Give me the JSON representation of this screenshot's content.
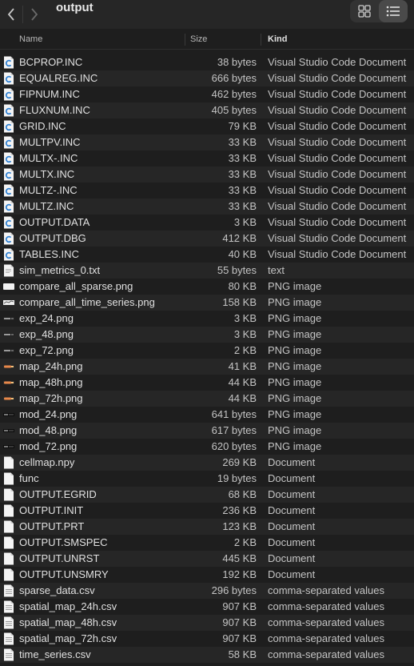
{
  "window": {
    "title": "output"
  },
  "columns": {
    "name": "Name",
    "size": "Size",
    "kind": "Kind"
  },
  "files": [
    {
      "name": "BCPROP.INC",
      "size": "38 bytes",
      "kind": "Visual Studio Code Document",
      "icon": "vscode-doc-icon"
    },
    {
      "name": "EQUALREG.INC",
      "size": "666 bytes",
      "kind": "Visual Studio Code Document",
      "icon": "vscode-doc-icon"
    },
    {
      "name": "FIPNUM.INC",
      "size": "462 bytes",
      "kind": "Visual Studio Code Document",
      "icon": "vscode-doc-icon"
    },
    {
      "name": "FLUXNUM.INC",
      "size": "405 bytes",
      "kind": "Visual Studio Code Document",
      "icon": "vscode-doc-icon"
    },
    {
      "name": "GRID.INC",
      "size": "79 KB",
      "kind": "Visual Studio Code Document",
      "icon": "vscode-doc-icon"
    },
    {
      "name": "MULTPV.INC",
      "size": "33 KB",
      "kind": "Visual Studio Code Document",
      "icon": "vscode-doc-icon"
    },
    {
      "name": "MULTX-.INC",
      "size": "33 KB",
      "kind": "Visual Studio Code Document",
      "icon": "vscode-doc-icon"
    },
    {
      "name": "MULTX.INC",
      "size": "33 KB",
      "kind": "Visual Studio Code Document",
      "icon": "vscode-doc-icon"
    },
    {
      "name": "MULTZ-.INC",
      "size": "33 KB",
      "kind": "Visual Studio Code Document",
      "icon": "vscode-doc-icon"
    },
    {
      "name": "MULTZ.INC",
      "size": "33 KB",
      "kind": "Visual Studio Code Document",
      "icon": "vscode-doc-icon"
    },
    {
      "name": "OUTPUT.DATA",
      "size": "3 KB",
      "kind": "Visual Studio Code Document",
      "icon": "vscode-doc-icon"
    },
    {
      "name": "OUTPUT.DBG",
      "size": "412 KB",
      "kind": "Visual Studio Code Document",
      "icon": "vscode-doc-icon"
    },
    {
      "name": "TABLES.INC",
      "size": "40 KB",
      "kind": "Visual Studio Code Document",
      "icon": "vscode-doc-icon"
    },
    {
      "name": "sim_metrics_0.txt",
      "size": "55 bytes",
      "kind": "text",
      "icon": "text-file-icon"
    },
    {
      "name": "compare_all_sparse.png",
      "size": "80 KB",
      "kind": "PNG image",
      "icon": "image-thumbnail-icon",
      "thumb": "white"
    },
    {
      "name": "compare_all_time_series.png",
      "size": "158 KB",
      "kind": "PNG image",
      "icon": "image-thumbnail-icon",
      "thumb": "plot"
    },
    {
      "name": "exp_24.png",
      "size": "3 KB",
      "kind": "PNG image",
      "icon": "image-thumbnail-icon",
      "thumb": "dark"
    },
    {
      "name": "exp_48.png",
      "size": "3 KB",
      "kind": "PNG image",
      "icon": "image-thumbnail-icon",
      "thumb": "dark"
    },
    {
      "name": "exp_72.png",
      "size": "2 KB",
      "kind": "PNG image",
      "icon": "image-thumbnail-icon",
      "thumb": "dark"
    },
    {
      "name": "map_24h.png",
      "size": "41 KB",
      "kind": "PNG image",
      "icon": "image-thumbnail-icon",
      "thumb": "map"
    },
    {
      "name": "map_48h.png",
      "size": "44 KB",
      "kind": "PNG image",
      "icon": "image-thumbnail-icon",
      "thumb": "map"
    },
    {
      "name": "map_72h.png",
      "size": "44 KB",
      "kind": "PNG image",
      "icon": "image-thumbnail-icon",
      "thumb": "map"
    },
    {
      "name": "mod_24.png",
      "size": "641 bytes",
      "kind": "PNG image",
      "icon": "image-thumbnail-icon",
      "thumb": "black"
    },
    {
      "name": "mod_48.png",
      "size": "617 bytes",
      "kind": "PNG image",
      "icon": "image-thumbnail-icon",
      "thumb": "black"
    },
    {
      "name": "mod_72.png",
      "size": "620 bytes",
      "kind": "PNG image",
      "icon": "image-thumbnail-icon",
      "thumb": "black"
    },
    {
      "name": "cellmap.npy",
      "size": "269 KB",
      "kind": "Document",
      "icon": "document-icon"
    },
    {
      "name": "func",
      "size": "19 bytes",
      "kind": "Document",
      "icon": "document-icon"
    },
    {
      "name": "OUTPUT.EGRID",
      "size": "68 KB",
      "kind": "Document",
      "icon": "document-icon"
    },
    {
      "name": "OUTPUT.INIT",
      "size": "236 KB",
      "kind": "Document",
      "icon": "document-icon"
    },
    {
      "name": "OUTPUT.PRT",
      "size": "123 KB",
      "kind": "Document",
      "icon": "document-icon"
    },
    {
      "name": "OUTPUT.SMSPEC",
      "size": "2 KB",
      "kind": "Document",
      "icon": "document-icon"
    },
    {
      "name": "OUTPUT.UNRST",
      "size": "445 KB",
      "kind": "Document",
      "icon": "document-icon"
    },
    {
      "name": "OUTPUT.UNSMRY",
      "size": "192 KB",
      "kind": "Document",
      "icon": "document-icon"
    },
    {
      "name": "sparse_data.csv",
      "size": "296 bytes",
      "kind": "comma-separated values",
      "icon": "csv-file-icon"
    },
    {
      "name": "spatial_map_24h.csv",
      "size": "907 KB",
      "kind": "comma-separated values",
      "icon": "csv-file-icon"
    },
    {
      "name": "spatial_map_48h.csv",
      "size": "907 KB",
      "kind": "comma-separated values",
      "icon": "csv-file-icon"
    },
    {
      "name": "spatial_map_72h.csv",
      "size": "907 KB",
      "kind": "comma-separated values",
      "icon": "csv-file-icon"
    },
    {
      "name": "time_series.csv",
      "size": "58 KB",
      "kind": "comma-separated values",
      "icon": "csv-file-icon"
    }
  ]
}
